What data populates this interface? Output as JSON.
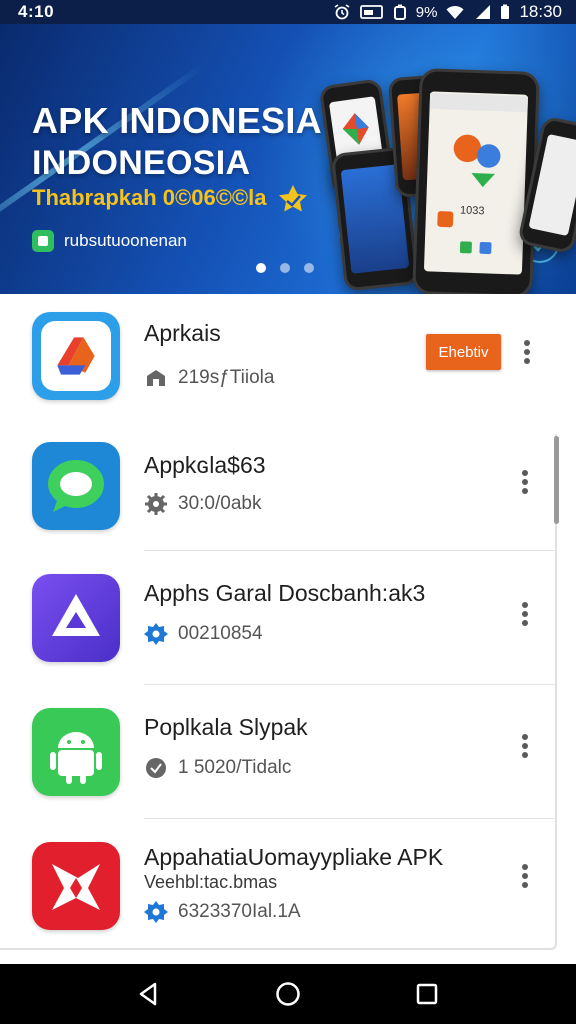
{
  "status_bar": {
    "time_left": "4:10",
    "battery_pct": "9%",
    "clock": "18:30"
  },
  "banner": {
    "title_line1": "APK INDONESIA",
    "title_line2": "INDONEOSIA",
    "subtitle": "Thabrapkah 0©06©©la",
    "tag": "rubsutuoonenan",
    "carousel_pages": 3,
    "carousel_active": 0,
    "phone_screen_text": "1033"
  },
  "apps": [
    {
      "name": "Aprkais",
      "meta": "219sƒTiiola",
      "meta_icon": "storage-icon",
      "button": "Ehebtiv",
      "icon": "red-arrow-app-icon"
    },
    {
      "name": "Appkɢla$63",
      "meta": "30:0/0abk",
      "meta_icon": "gear-icon",
      "icon": "green-chat-app-icon"
    },
    {
      "name": "Apphs Garal Doscbanh:ak3",
      "meta": "00210854",
      "meta_icon": "badge-icon",
      "icon": "purple-triangle-app-icon"
    },
    {
      "name": "Poplkala Slypak",
      "meta": "1 5020/Tidalc",
      "meta_icon": "settings-badge-icon",
      "icon": "android-app-icon"
    },
    {
      "name": "AppahatiaUomayypliake APK",
      "sub": "Veehbl:tac.bmas",
      "meta": "6323370Ial.1A",
      "meta_icon": "badge-icon",
      "icon": "red-star-app-icon"
    }
  ],
  "colors": {
    "banner_blue": "#1553b8",
    "accent_orange": "#e8641d",
    "title_yellow": "#f5c31c"
  }
}
